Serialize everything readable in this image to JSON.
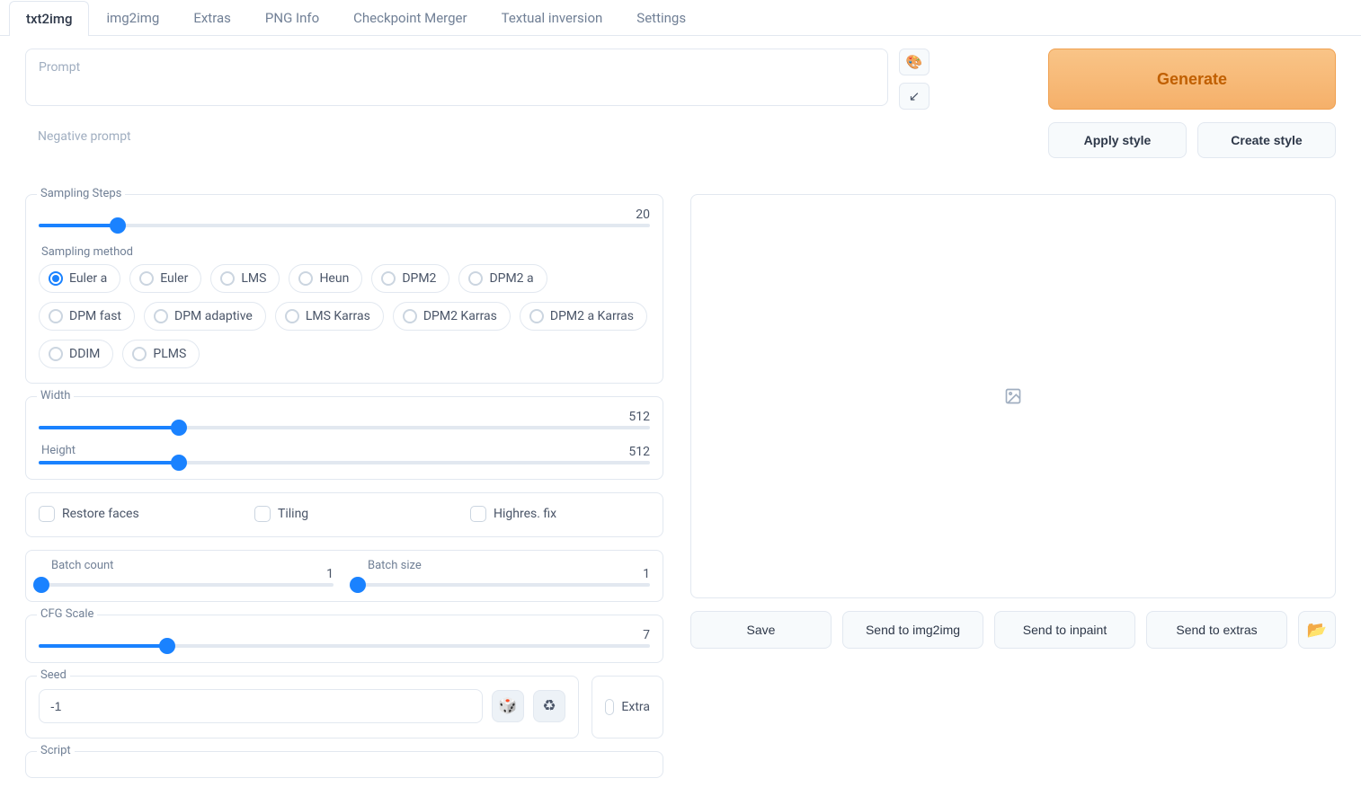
{
  "tabs": [
    "txt2img",
    "img2img",
    "Extras",
    "PNG Info",
    "Checkpoint Merger",
    "Textual inversion",
    "Settings"
  ],
  "activeTab": "txt2img",
  "prompt": {
    "placeholder": "Prompt",
    "value": ""
  },
  "negative_prompt": {
    "placeholder": "Negative prompt",
    "value": ""
  },
  "buttons": {
    "generate": "Generate",
    "apply_style": "Apply style",
    "create_style": "Create style",
    "save": "Save",
    "send_img2img": "Send to img2img",
    "send_inpaint": "Send to inpaint",
    "send_extras": "Send to extras"
  },
  "sampling_steps": {
    "label": "Sampling Steps",
    "value": 20,
    "percent": 13
  },
  "sampling_method": {
    "label": "Sampling method",
    "selected": "Euler a",
    "options": [
      "Euler a",
      "Euler",
      "LMS",
      "Heun",
      "DPM2",
      "DPM2 a",
      "DPM fast",
      "DPM adaptive",
      "LMS Karras",
      "DPM2 Karras",
      "DPM2 a Karras",
      "DDIM",
      "PLMS"
    ]
  },
  "width": {
    "label": "Width",
    "value": 512,
    "percent": 23
  },
  "height": {
    "label": "Height",
    "value": 512,
    "percent": 23
  },
  "checks": {
    "restore_faces": {
      "label": "Restore faces",
      "checked": false
    },
    "tiling": {
      "label": "Tiling",
      "checked": false
    },
    "highres_fix": {
      "label": "Highres. fix",
      "checked": false
    }
  },
  "batch_count": {
    "label": "Batch count",
    "value": 1,
    "percent": 0
  },
  "batch_size": {
    "label": "Batch size",
    "value": 1,
    "percent": 0
  },
  "cfg_scale": {
    "label": "CFG Scale",
    "value": 7,
    "percent": 21
  },
  "seed": {
    "label": "Seed",
    "value": "-1",
    "extra_label": "Extra"
  },
  "script": {
    "label": "Script"
  },
  "icons": {
    "palette": "🎨",
    "arrow": "↙",
    "dice": "🎲",
    "recycle": "♻",
    "folder": "📂"
  }
}
